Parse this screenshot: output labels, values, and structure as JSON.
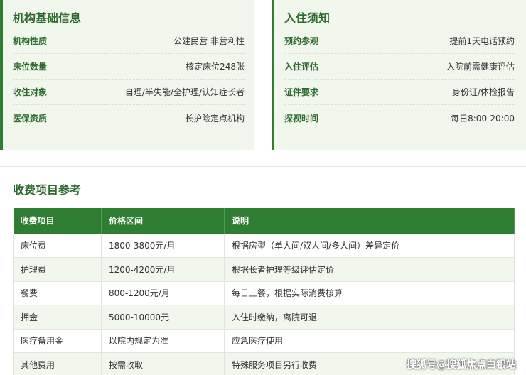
{
  "institution_info": {
    "title": "机构基础信息",
    "rows": [
      {
        "label": "机构性质",
        "value": "公建民营 非营利性"
      },
      {
        "label": "床位数量",
        "value": "核定床位248张"
      },
      {
        "label": "收住对象",
        "value": "自理/半失能/全护理/认知症长者"
      },
      {
        "label": "医保资质",
        "value": "长护险定点机构"
      }
    ]
  },
  "admission_notice": {
    "title": "入住须知",
    "rows": [
      {
        "label": "预约参观",
        "value": "提前1天电话预约"
      },
      {
        "label": "入住评估",
        "value": "入院前需健康评估"
      },
      {
        "label": "证件要求",
        "value": "身份证/体检报告"
      },
      {
        "label": "探视时间",
        "value": "每日8:00-20:00"
      }
    ]
  },
  "fees": {
    "title": "收费项目参考",
    "headers": [
      "收费项目",
      "价格区间",
      "说明"
    ],
    "rows": [
      [
        "床位费",
        "1800-3800元/月",
        "根据房型（单人间/双人间/多人间）差异定价"
      ],
      [
        "护理费",
        "1200-4200元/月",
        "根据长者护理等级评估定价"
      ],
      [
        "餐费",
        "800-1200元/月",
        "每日三餐，根据实际消费核算"
      ],
      [
        "押金",
        "5000-10000元",
        "入住时缴纳，离院可退"
      ],
      [
        "医疗备用金",
        "以院内规定为准",
        "应急医疗使用"
      ],
      [
        "其他费用",
        "按需收取",
        "特殊服务项目另行收费"
      ]
    ]
  },
  "watermark": "搜狐号@搜狐焦点白银站",
  "colors": {
    "accent": "#2e7d32",
    "card_bg": "#f1f7ec"
  }
}
